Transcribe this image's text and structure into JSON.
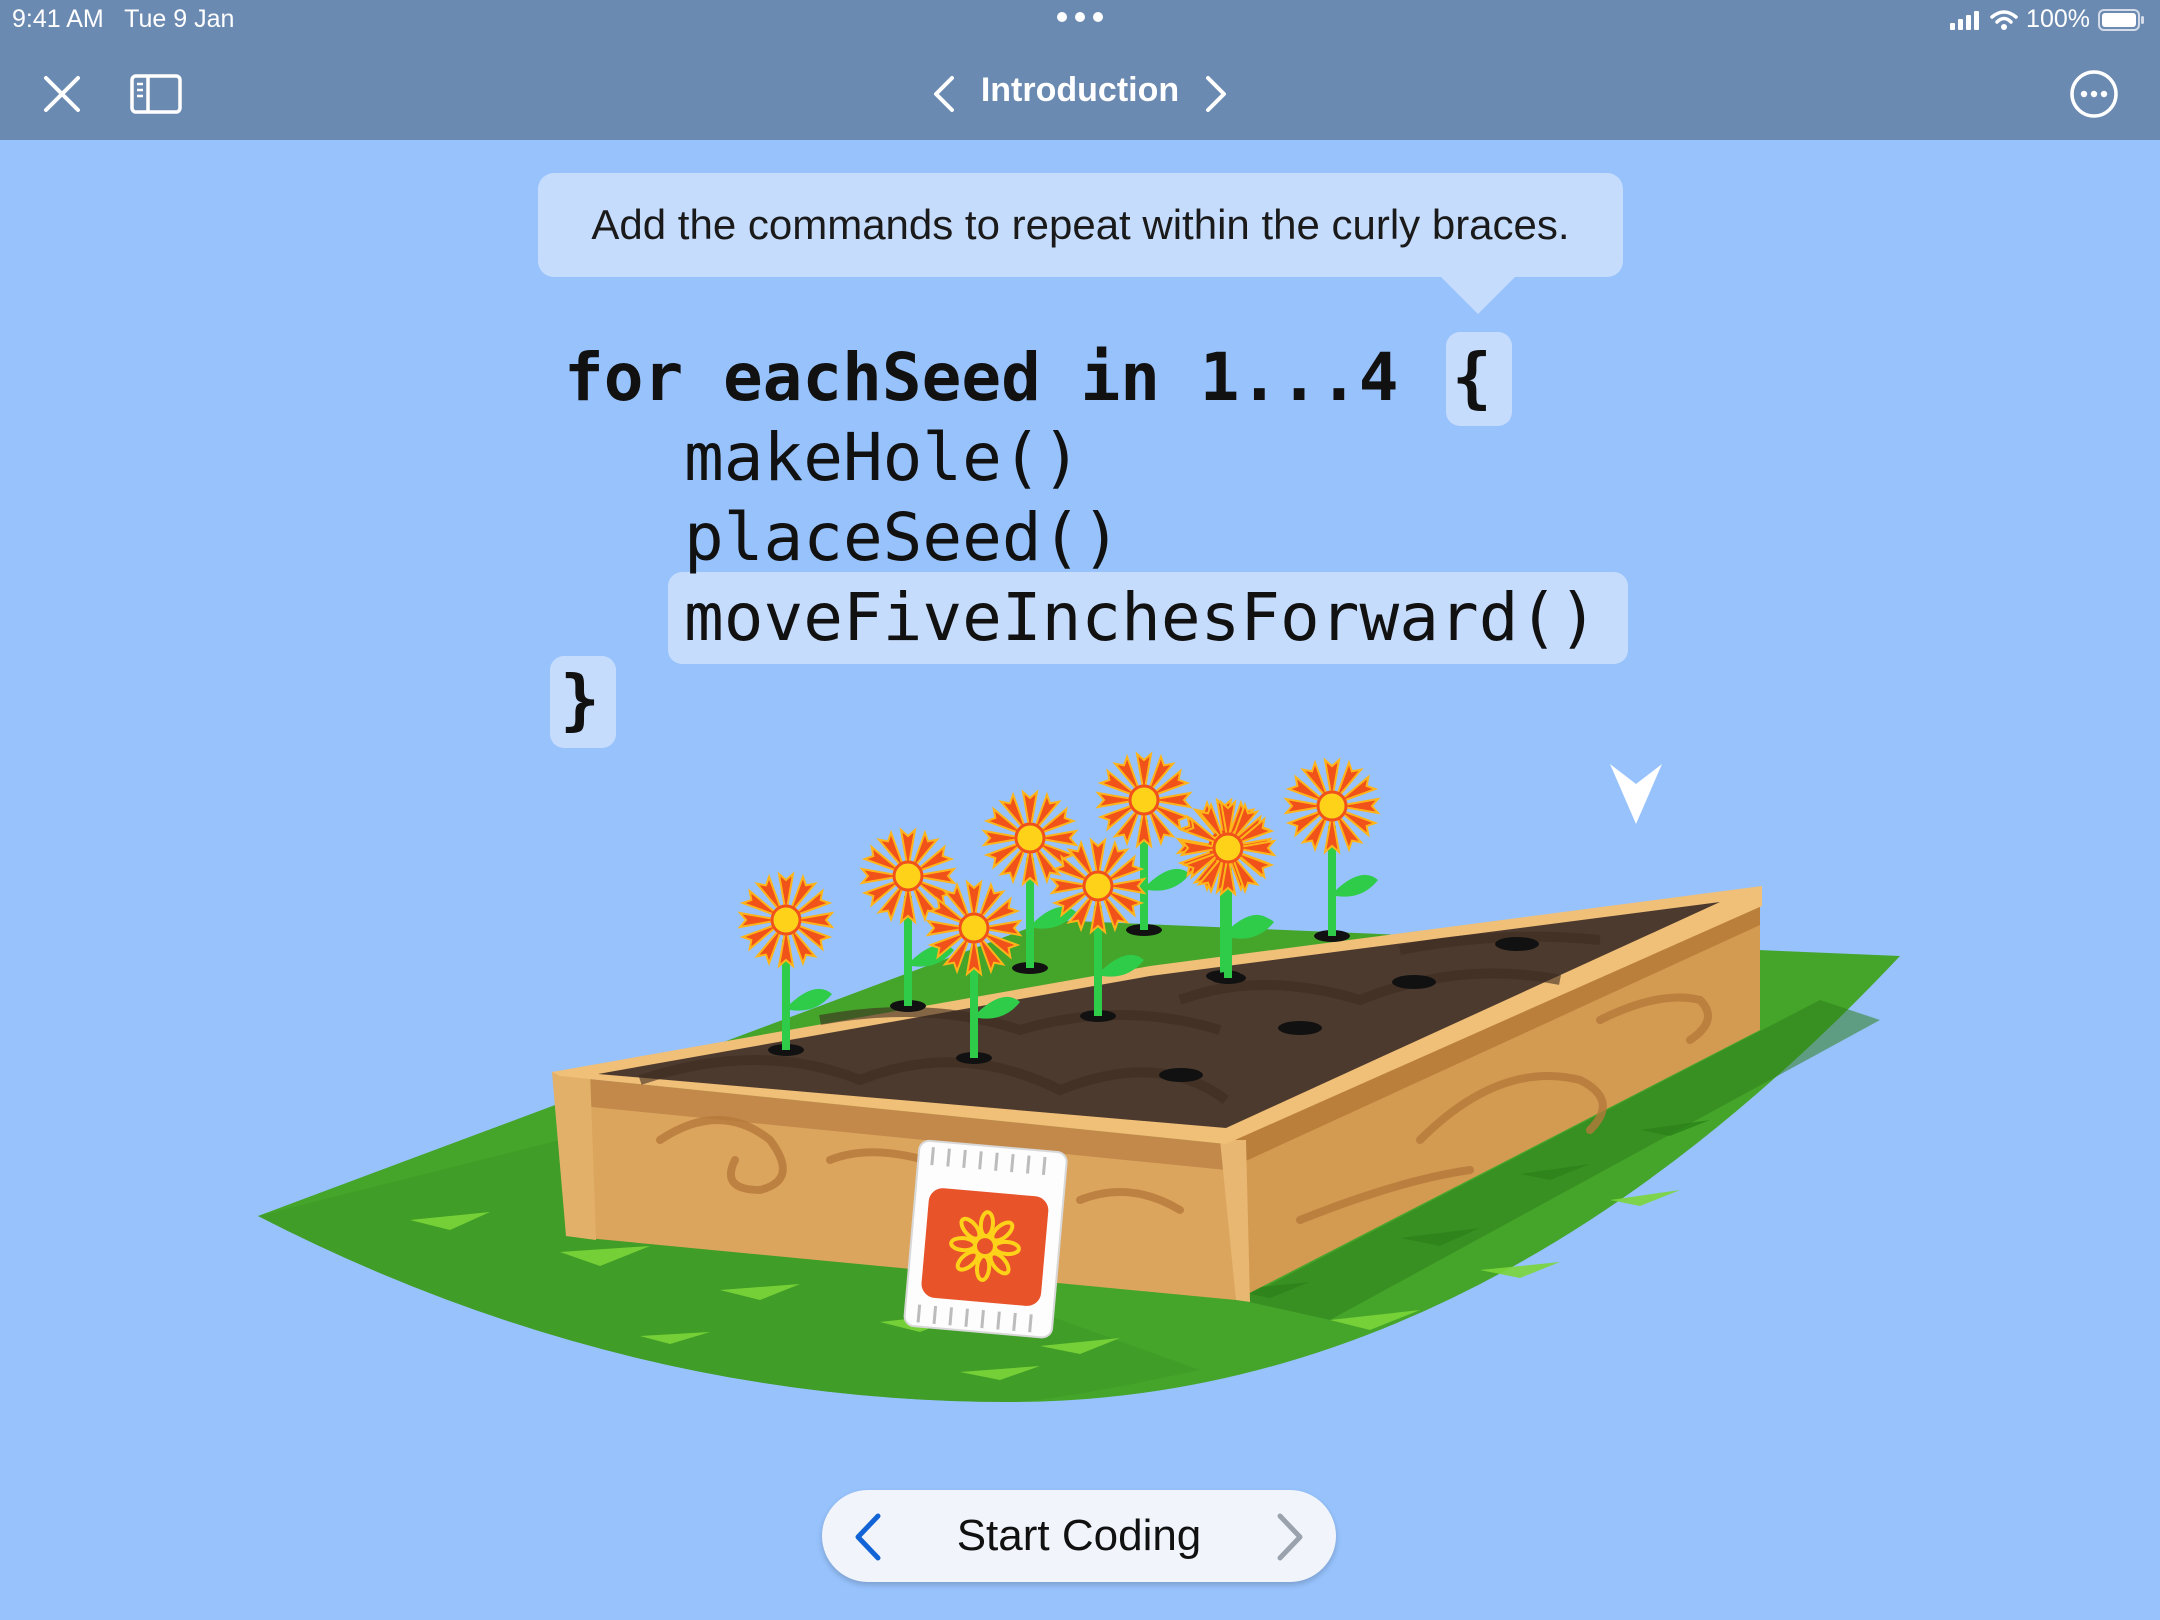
{
  "status_bar": {
    "time": "9:41 AM",
    "date": "Tue 9 Jan",
    "battery_text": "100%",
    "battery_level": 1.0,
    "icons": [
      "signal-icon",
      "wifi-icon",
      "battery-icon"
    ]
  },
  "nav": {
    "title": "Introduction",
    "icons": [
      "close-icon",
      "sidebar-icon",
      "chevron-left-icon",
      "chevron-right-icon",
      "more-icon"
    ]
  },
  "instruction": {
    "text": "Add the commands to repeat within the curly braces."
  },
  "code": {
    "line1_keyword": "for eachSeed in 1...4 ",
    "open_brace": "{",
    "line2": "makeHole()",
    "line3": "placeSeed()",
    "line4": "moveFiveInchesForward()",
    "close_brace": "}"
  },
  "footer": {
    "start_label": "Start Coding",
    "icons": [
      "chevron-left-icon",
      "chevron-right-icon"
    ]
  },
  "colors": {
    "background": "#97c2fc",
    "bar": "#6b8ab1",
    "highlight": "#c6dcfd",
    "grass": "#45a52a",
    "wood": "#d9a35b",
    "soil": "#4d3a2e",
    "petal": "#f0521a",
    "flower_center": "#ffd21a",
    "stem": "#2fcc4a",
    "accent_blue": "#1263d6"
  }
}
